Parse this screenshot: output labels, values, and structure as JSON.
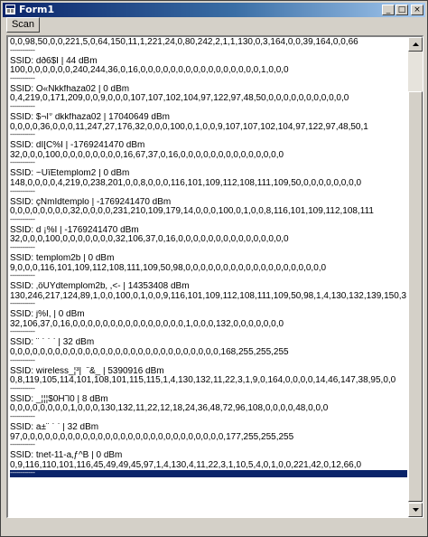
{
  "window": {
    "title": "Form1",
    "minimize_label": "_",
    "maximize_label": "□",
    "close_label": "×"
  },
  "toolbar": {
    "scan_label": "Scan"
  },
  "list": {
    "lines": [
      {
        "type": "data",
        "text": "0,0,98,50,0,0,221,5,0,64,150,11,1,221,24,0,80,242,2,1,1,130,0,3,164,0,0,39,164,0,0,66"
      },
      {
        "type": "sep",
        "text": "---------------"
      },
      {
        "type": "ssid",
        "text": "SSID: dð6$Ì  |  44 dBm"
      },
      {
        "type": "data",
        "text": "100,0,0,0,0,0,0,240,244,36,0,16,0,0,0,0,0,0,0,0,0,0,0,0,0,0,0,0,1,0,0,0"
      },
      {
        "type": "sep",
        "text": "---------------"
      },
      {
        "type": "ssid",
        "text": "SSID: Ô«Ñkkfhaza02  |  0 dBm"
      },
      {
        "type": "data",
        "text": "0,4,219,0,171,209,0,0,9,0,0,0,107,107,102,104,97,122,97,48,50,0,0,0,0,0,0,0,0,0,0,0"
      },
      {
        "type": "sep",
        "text": "---------------"
      },
      {
        "type": "ssid",
        "text": "SSID: $¬Ì° dkkfhaza02  |  17040649 dBm"
      },
      {
        "type": "data",
        "text": "0,0,0,0,36,0,0,0,11,247,27,176,32,0,0,0,100,0,1,0,0,9,107,107,102,104,97,122,97,48,50,1"
      },
      {
        "type": "sep",
        "text": "---------------"
      },
      {
        "type": "ssid",
        "text": "SSID: dÌ[C%Ì  |  -1769241470 dBm"
      },
      {
        "type": "data",
        "text": "32,0,0,0,100,0,0,0,0,0,0,0,0,16,67,37,0,16,0,0,0,0,0,0,0,0,0,0,0,0,0,0"
      },
      {
        "type": "sep",
        "text": "---------------"
      },
      {
        "type": "ssid",
        "text": "SSID: ~ÛîÊtemplom2  |  0 dBm"
      },
      {
        "type": "data",
        "text": "148,0,0,0,0,4,219,0,238,201,0,0,8,0,0,0,116,101,109,112,108,111,109,50,0,0,0,0,0,0,0,0"
      },
      {
        "type": "sep",
        "text": "---------------"
      },
      {
        "type": "ssid",
        "text": "SSID: çÑmÌdtemplo  |  -1769241470 dBm"
      },
      {
        "type": "data",
        "text": "0,0,0,0,0,0,0,0,32,0,0,0,0,231,210,109,179,14,0,0,0,100,0,1,0,0,8,116,101,109,112,108,111"
      },
      {
        "type": "sep",
        "text": "---------------"
      },
      {
        "type": "ssid",
        "text": "SSID:  d ¡%Ì  |  -1769241470 dBm"
      },
      {
        "type": "data",
        "text": "32,0,0,0,100,0,0,0,0,0,0,0,32,106,37,0,16,0,0,0,0,0,0,0,0,0,0,0,0,0,0,0"
      },
      {
        "type": "sep",
        "text": "---------------"
      },
      {
        "type": "ssid",
        "text": "SSID: templom2b  |  0 dBm"
      },
      {
        "type": "data",
        "text": "9,0,0,0,116,101,109,112,108,111,109,50,98,0,0,0,0,0,0,0,0,0,0,0,0,0,0,0,0,0,0,0"
      },
      {
        "type": "sep",
        "text": "---------------"
      },
      {
        "type": "ssid",
        "text": "SSID: ‚öÛÝdtemplom2b‚ ,<-  |  14353408 dBm"
      },
      {
        "type": "data",
        "text": "130,246,217,124,89,1,0,0,100,0,1,0,0,9,116,101,109,112,108,111,109,50,98,1,4,130,132,139,150,3,1,5"
      },
      {
        "type": "sep",
        "text": "---------------"
      },
      {
        "type": "ssid",
        "text": "SSID: j%Ì,  |  0 dBm"
      },
      {
        "type": "data",
        "text": "32,106,37,0,16,0,0,0,0,0,0,0,0,0,0,0,0,0,0,0,1,0,0,0,132,0,0,0,0,0,0,0"
      },
      {
        "type": "sep",
        "text": "---------------"
      },
      {
        "type": "ssid",
        "text": "SSID: ¨ ` ` `  |  32 dBm"
      },
      {
        "type": "data",
        "text": "0,0,0,0,0,0,0,0,0,0,0,0,0,0,0,0,0,0,0,0,0,0,0,0,0,0,0,0,168,255,255,255"
      },
      {
        "type": "sep",
        "text": "---------------"
      },
      {
        "type": "ssid",
        "text": "SSID: wireless_¦³|¯ˆ&_  |  5390916 dBm"
      },
      {
        "type": "data",
        "text": "0,8,119,105,114,101,108,101,115,115,1,4,130,132,11,22,3,1,9,0,164,0,0,0,0,14,46,147,38,95,0,0"
      },
      {
        "type": "sep",
        "text": "---------------"
      },
      {
        "type": "ssid",
        "text": "SSID: _¦¦¦$0H˜l0  |  8 dBm"
      },
      {
        "type": "data",
        "text": "0,0,0,0,0,0,0,0,1,0,0,0,130,132,11,22,12,18,24,36,48,72,96,108,0,0,0,0,48,0,0,0"
      },
      {
        "type": "sep",
        "text": "---------------"
      },
      {
        "type": "ssid",
        "text": "SSID: a±¨ ` `  |  32 dBm"
      },
      {
        "type": "data",
        "text": "97,0,0,0,0,0,0,0,0,0,0,0,0,0,0,0,0,0,0,0,0,0,0,0,0,0,0,0,177,255,255,255"
      },
      {
        "type": "sep",
        "text": "---------------"
      },
      {
        "type": "ssid",
        "text": "SSID: tnet-11-a‚ƒ^B  |  0 dBm"
      },
      {
        "type": "data",
        "text": "0,9,116,110,101,116,45,49,49,45,97,1,4,130,4,11,22,3,1,10,5,4,0,1,0,0,221,42,0,12,66,0"
      },
      {
        "type": "sel",
        "text": "---------------"
      }
    ]
  }
}
